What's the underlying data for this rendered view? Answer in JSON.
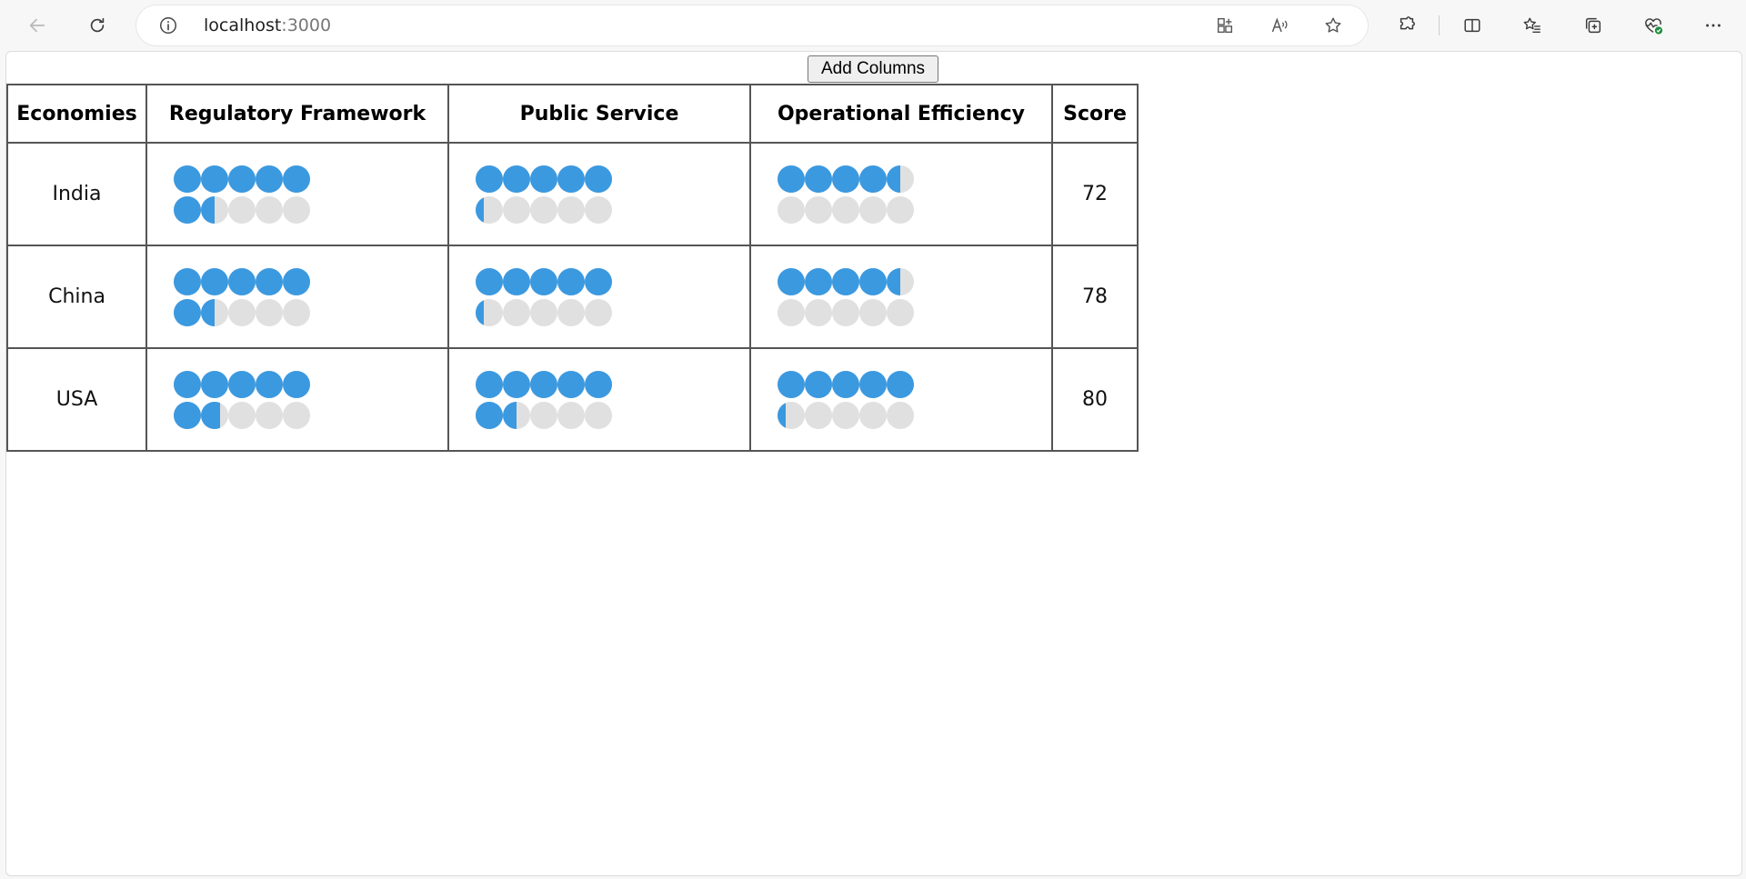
{
  "browser": {
    "url_host": "localhost",
    "url_port": ":3000"
  },
  "page": {
    "add_columns_label": "Add Columns",
    "columns": [
      "Economies",
      "Regulatory Framework",
      "Public Service",
      "Operational Efficiency",
      "Score"
    ],
    "dots_per_metric": 10,
    "dot_color_filled": "#3b99e0",
    "dot_color_empty": "#e0e0e0",
    "rows": [
      {
        "economy": "India",
        "regulatory_framework": 6.5,
        "public_service": 5.3,
        "operational_efficiency": 4.5,
        "score": "72"
      },
      {
        "economy": "China",
        "regulatory_framework": 6.5,
        "public_service": 5.3,
        "operational_efficiency": 4.5,
        "score": "78"
      },
      {
        "economy": "USA",
        "regulatory_framework": 6.7,
        "public_service": 6.5,
        "operational_efficiency": 5.3,
        "score": "80"
      }
    ]
  }
}
